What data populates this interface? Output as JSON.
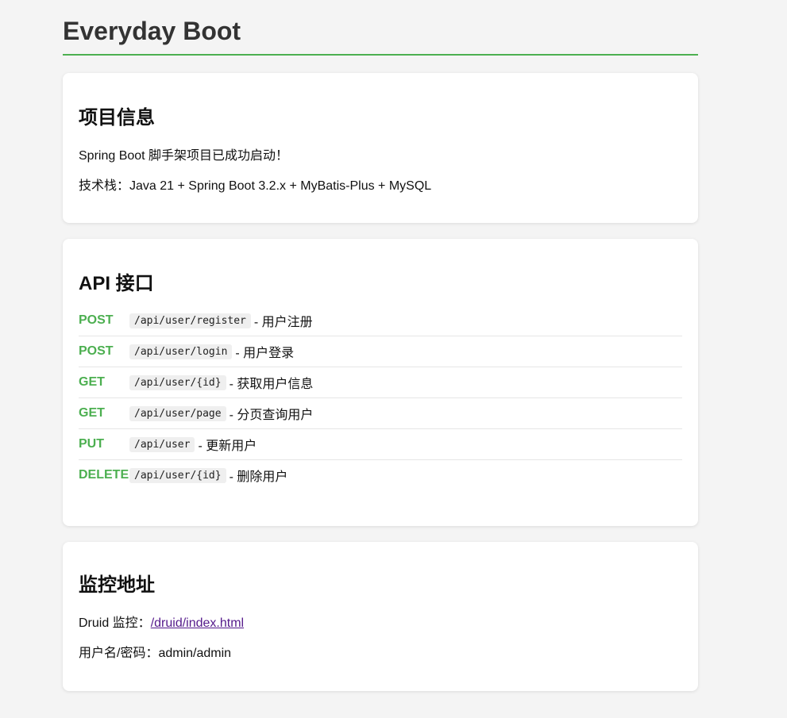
{
  "page": {
    "title": "Everyday Boot"
  },
  "project_info": {
    "heading": "项目信息",
    "line1": "Spring Boot 脚手架项目已成功启动！",
    "line2": "技术栈：Java 21 + Spring Boot 3.2.x + MyBatis-Plus + MySQL"
  },
  "api": {
    "heading": "API 接口",
    "items": [
      {
        "method": "POST",
        "path": "/api/user/register",
        "desc": "- 用户注册"
      },
      {
        "method": "POST",
        "path": "/api/user/login",
        "desc": "- 用户登录"
      },
      {
        "method": "GET",
        "path": "/api/user/{id}",
        "desc": "- 获取用户信息"
      },
      {
        "method": "GET",
        "path": "/api/user/page",
        "desc": "- 分页查询用户"
      },
      {
        "method": "PUT",
        "path": "/api/user",
        "desc": "- 更新用户"
      },
      {
        "method": "DELETE",
        "path": "/api/user/{id}",
        "desc": "- 删除用户"
      }
    ]
  },
  "monitor": {
    "heading": "监控地址",
    "druid_label": "Druid 监控：",
    "druid_link": "/druid/index.html",
    "credentials": "用户名/密码：admin/admin"
  },
  "colors": {
    "accent": "#4caf50",
    "link": "#551a8b",
    "background": "#f4f4f4"
  }
}
